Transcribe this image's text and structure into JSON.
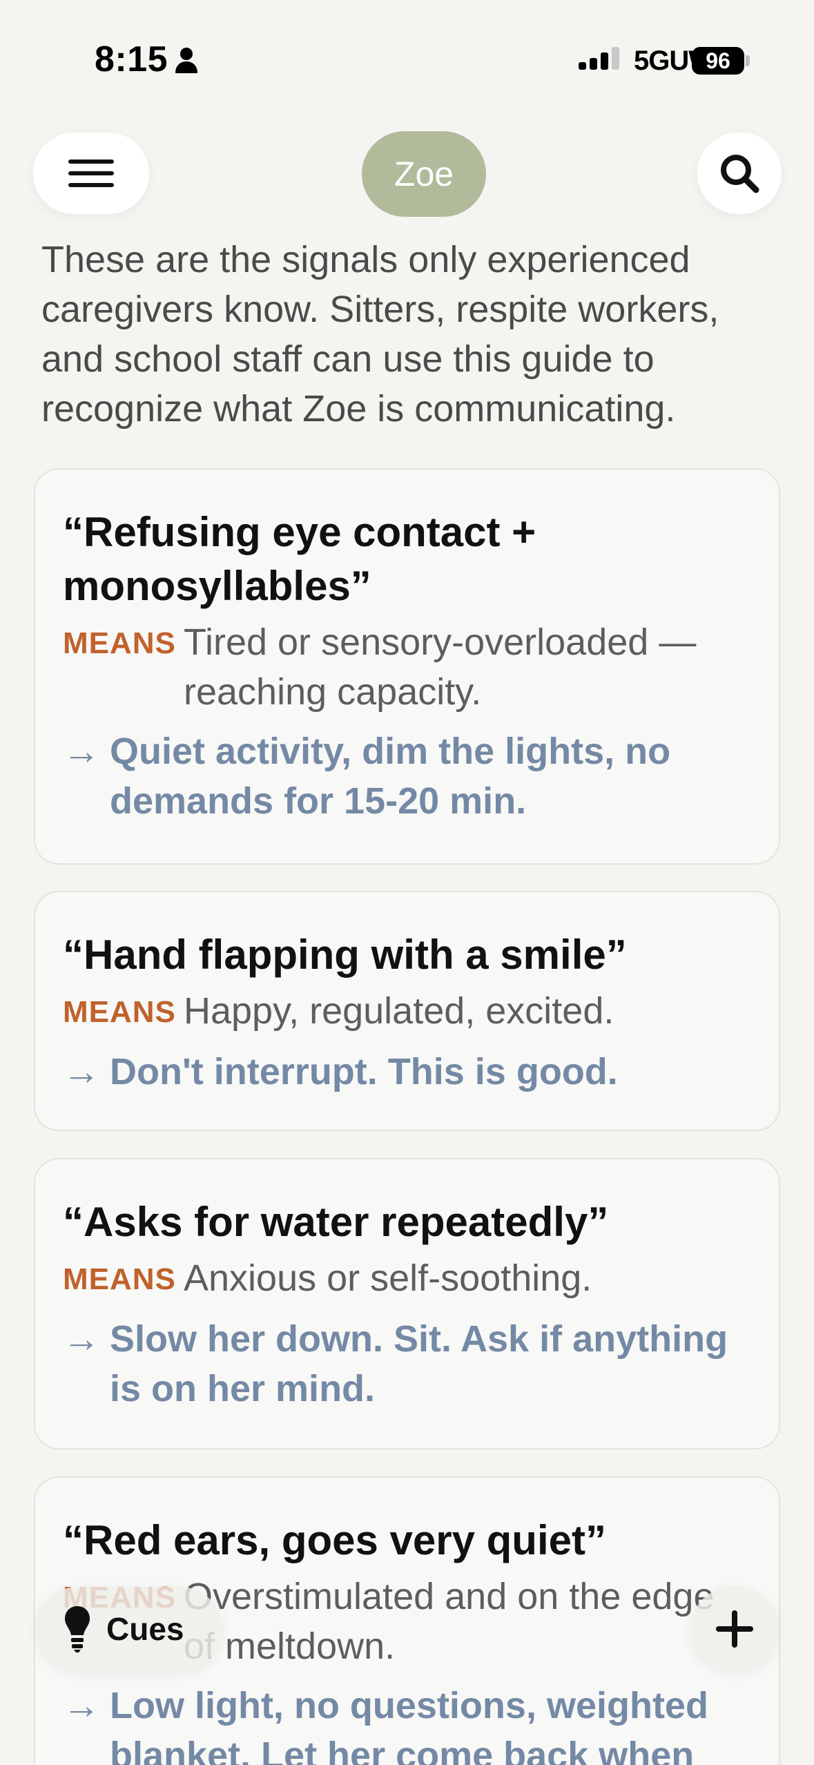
{
  "status_bar": {
    "time": "8:15",
    "network": "5GUW",
    "battery": "96"
  },
  "header": {
    "profile_name": "Zoe"
  },
  "intro": "These are the signals only experienced caregivers know. Sitters, respite workers, and school staff can use this guide to recognize what Zoe is communicating.",
  "means_label": "MEANS",
  "arrow": "→",
  "cards": [
    {
      "title": "“Refusing eye contact + monosyllables”",
      "means": "Tired or sensory-overloaded — reaching capacity.",
      "action": "Quiet activity, dim the lights, no demands for 15-20 min."
    },
    {
      "title": "“Hand flapping with a smile”",
      "means": "Happy, regulated, excited.",
      "action": "Don't interrupt. This is good."
    },
    {
      "title": "“Asks for water repeatedly”",
      "means": "Anxious or self-soothing.",
      "action": "Slow her down. Sit. Ask if anything is on her mind."
    },
    {
      "title": "“Red ears, goes very quiet”",
      "means": "Overstimulated and on the edge of meltdown.",
      "action": "Low light, no questions, weighted blanket. Let her come back when"
    }
  ],
  "bottom_bar": {
    "cues_label": "Cues"
  },
  "colors": {
    "background": "#f5f4f0",
    "means_accent": "#c0622c",
    "action_accent": "#7489a5",
    "profile_pill": "#b1bb9b"
  },
  "icons": [
    "person-icon",
    "signal-icon",
    "menu-icon",
    "search-icon",
    "lightbulb-icon",
    "plus-icon"
  ]
}
